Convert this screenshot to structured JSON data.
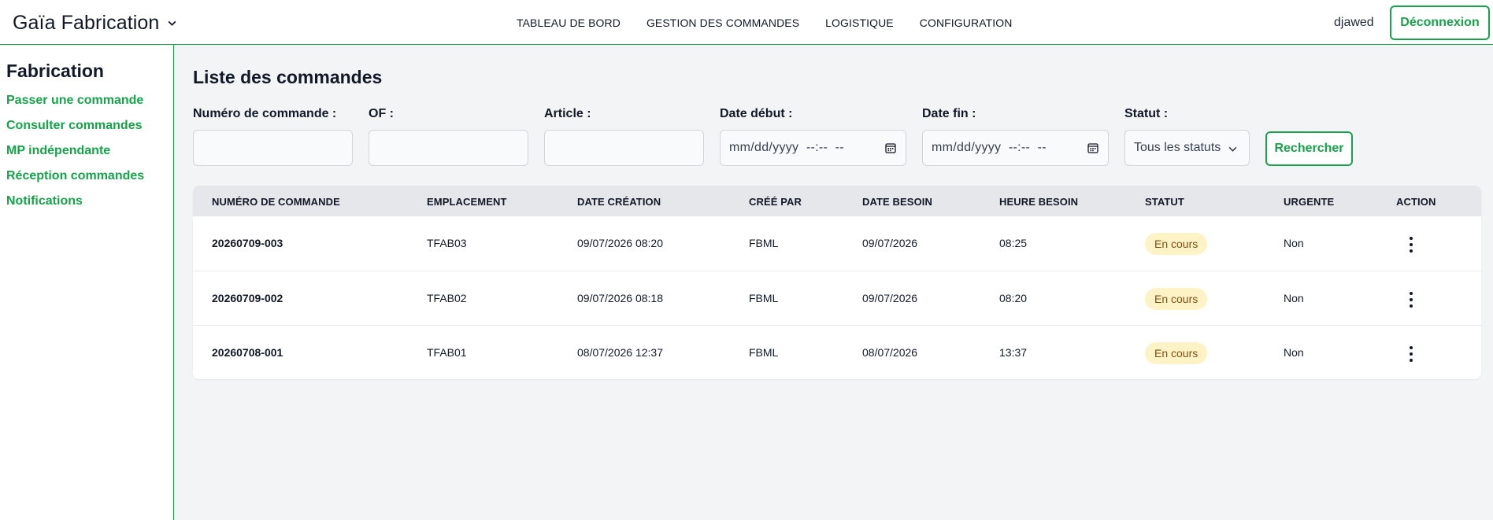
{
  "header": {
    "brand": "Gaïa Fabrication",
    "nav": [
      "TABLEAU DE BORD",
      "GESTION DES COMMANDES",
      "LOGISTIQUE",
      "CONFIGURATION"
    ],
    "username": "djawed",
    "logout_label": "Déconnexion"
  },
  "sidebar": {
    "title": "Fabrication",
    "items": [
      {
        "label": "Passer une commande"
      },
      {
        "label": "Consulter commandes"
      },
      {
        "label": "MP indépendante"
      },
      {
        "label": "Réception commandes"
      },
      {
        "label": "Notifications"
      }
    ]
  },
  "main": {
    "title": "Liste des commandes",
    "filters": {
      "order_number": {
        "label": "Numéro de commande :",
        "value": ""
      },
      "of": {
        "label": "OF :",
        "value": ""
      },
      "article": {
        "label": "Article :",
        "value": ""
      },
      "date_start": {
        "label": "Date début :",
        "placeholder": "mm/dd/yyyy  --:--  --"
      },
      "date_end": {
        "label": "Date fin :",
        "placeholder": "mm/dd/yyyy  --:--  --"
      },
      "status": {
        "label": "Statut :",
        "value": "Tous les statuts"
      },
      "search_label": "Rechercher"
    },
    "table": {
      "columns": [
        "NUMÉRO DE COMMANDE",
        "EMPLACEMENT",
        "DATE CRÉATION",
        "CRÉÉ PAR",
        "DATE BESOIN",
        "HEURE BESOIN",
        "STATUT",
        "URGENTE",
        "ACTION"
      ],
      "rows": [
        {
          "order": "20260709-003",
          "location": "TFAB03",
          "created": "09/07/2026 08:20",
          "by": "FBML",
          "need_date": "09/07/2026",
          "need_time": "08:25",
          "status": "En cours",
          "urgent": "Non"
        },
        {
          "order": "20260709-002",
          "location": "TFAB02",
          "created": "09/07/2026 08:18",
          "by": "FBML",
          "need_date": "09/07/2026",
          "need_time": "08:20",
          "status": "En cours",
          "urgent": "Non"
        },
        {
          "order": "20260708-001",
          "location": "TFAB01",
          "created": "08/07/2026 12:37",
          "by": "FBML",
          "need_date": "08/07/2026",
          "need_time": "13:37",
          "status": "En cours",
          "urgent": "Non"
        }
      ]
    }
  },
  "colors": {
    "accent": "#16a34a",
    "badge_bg": "#fef3c7",
    "badge_text": "#854d0e",
    "page_bg": "#f3f4f6",
    "table_header_bg": "#e5e7eb"
  }
}
